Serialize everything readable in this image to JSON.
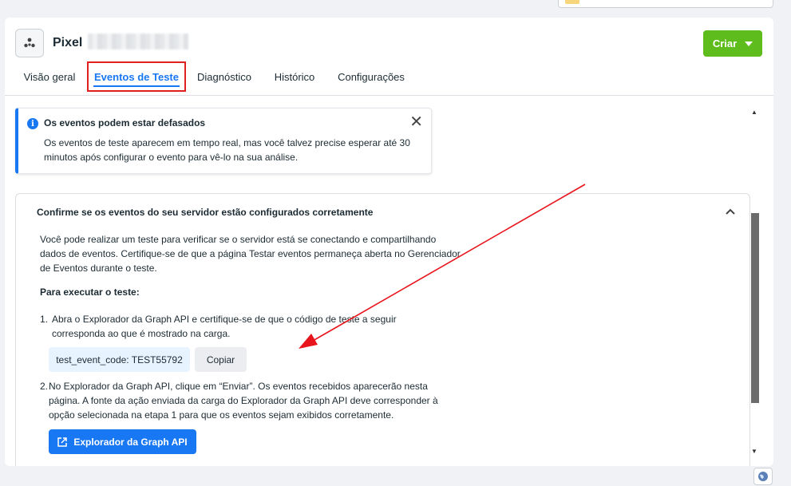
{
  "header": {
    "pixel_label": "Pixel",
    "create_label": "Criar",
    "tabs": [
      {
        "label": "Visão geral"
      },
      {
        "label": "Eventos de Teste"
      },
      {
        "label": "Diagnóstico"
      },
      {
        "label": "Histórico"
      },
      {
        "label": "Configurações"
      }
    ],
    "active_tab": "Eventos de Teste",
    "accent_color": "#1877f2",
    "create_color": "#5ebd1d"
  },
  "banner": {
    "title": "Os eventos podem estar defasados",
    "text": "Os eventos de teste aparecem em tempo real, mas você talvez precise esperar até 30 minutos após configurar o evento para vê-lo na sua análise.",
    "icon": "info-icon",
    "close_glyph": "✕"
  },
  "section": {
    "title": "Confirme se os eventos do seu servidor estão configurados corretamente",
    "intro": "Você pode realizar um teste para verificar se o servidor está se conectando e compartilhando dados de eventos. Certifique-se de que a página Testar eventos permaneça aberta no Gerenciador de Eventos durante o teste.",
    "steps_heading": "Para executar o teste:",
    "step1_num": "1.",
    "step1_text": "Abra o Explorador da Graph API e certifique-se de que o código de teste a seguir corresponda ao que é mostrado na carga.",
    "test_code": "test_event_code: TEST55792",
    "copy_label": "Copiar",
    "step2_num": "2.",
    "step2_text": "No Explorador da Graph API, clique em “Enviar”. Os eventos recebidos aparecerão nesta página. A fonte da ação enviada da carga do Explorador da Graph API deve corresponder à opção selecionada na etapa 1 para que os eventos sejam exibidos corretamente.",
    "api_button_label": "Explorador da Graph API"
  }
}
